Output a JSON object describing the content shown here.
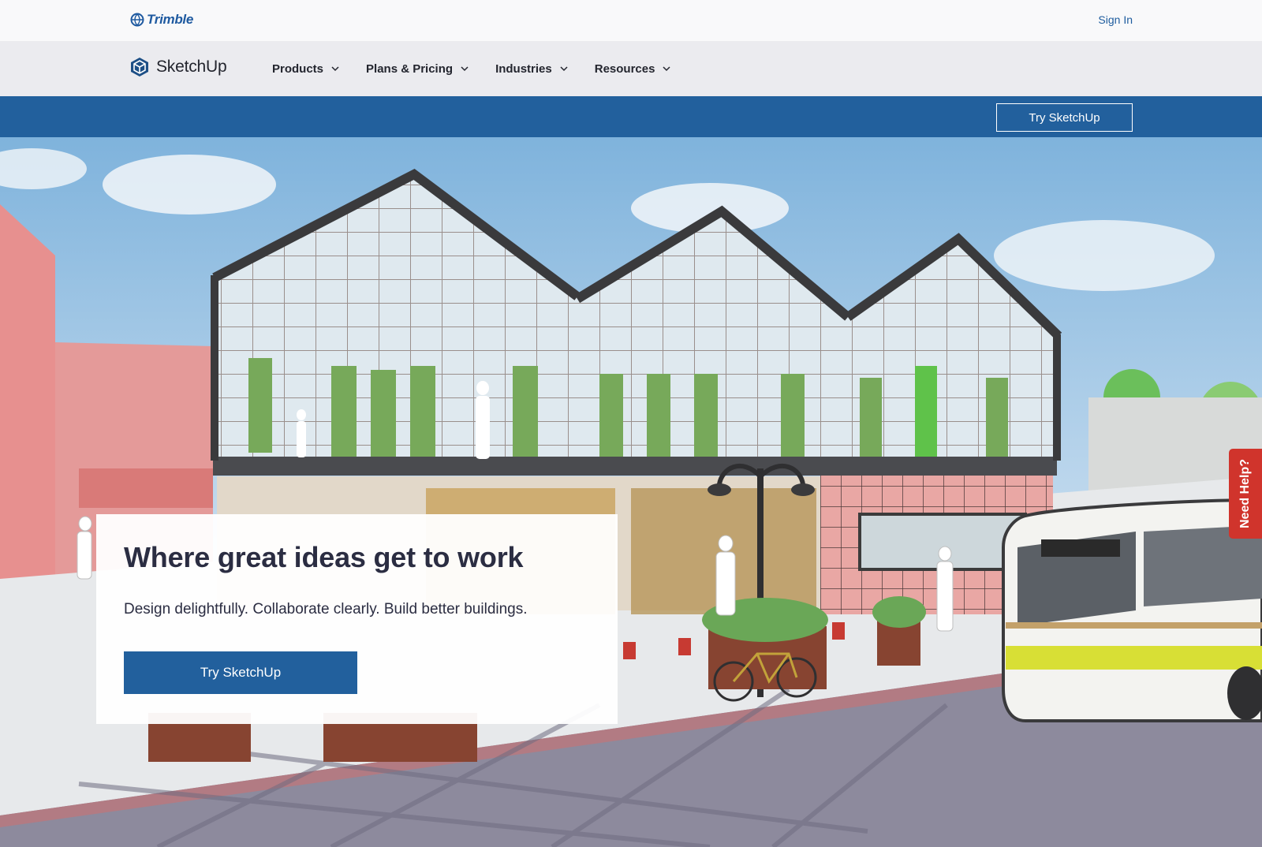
{
  "utility_bar": {
    "brand": "Trimble",
    "sign_in": "Sign In"
  },
  "nav": {
    "brand": "SketchUp",
    "items": [
      {
        "label": "Products",
        "icon": "chevron-down-icon"
      },
      {
        "label": "Plans & Pricing",
        "icon": "chevron-down-icon"
      },
      {
        "label": "Industries",
        "icon": "chevron-down-icon"
      },
      {
        "label": "Resources",
        "icon": "chevron-down-icon"
      }
    ]
  },
  "cta_strip": {
    "button": "Try SketchUp"
  },
  "hero": {
    "title": "Where great ideas get to work",
    "subtitle": "Design delightfully. Collaborate clearly. Build better buildings.",
    "button": "Try SketchUp",
    "image_icon": "greenhouse-illustration"
  },
  "help_tab": {
    "label": "Need Help?"
  },
  "colors": {
    "brand_blue": "#22609d",
    "nav_bg": "#ebebef",
    "help_red": "#d0342c",
    "text_dark": "#2b2d42"
  }
}
